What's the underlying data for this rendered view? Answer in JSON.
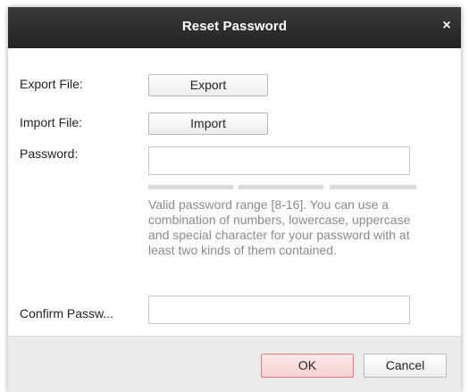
{
  "dialog": {
    "title": "Reset Password",
    "close_icon": "×"
  },
  "form": {
    "export_label": "Export File:",
    "export_button": "Export",
    "import_label": "Import File:",
    "import_button": "Import",
    "password_label": "Password:",
    "password_value": "",
    "hint": "Valid password range [8-16]. You can use a combination of numbers, lowercase, uppercase and special character for your password with at least two kinds of them contained.",
    "confirm_label": "Confirm Passw...",
    "confirm_value": ""
  },
  "footer": {
    "ok_label": "OK",
    "cancel_label": "Cancel"
  },
  "colors": {
    "titlebar": "#2c2c2c",
    "ok_border": "#e08080",
    "footer_bg": "#ebebeb"
  }
}
